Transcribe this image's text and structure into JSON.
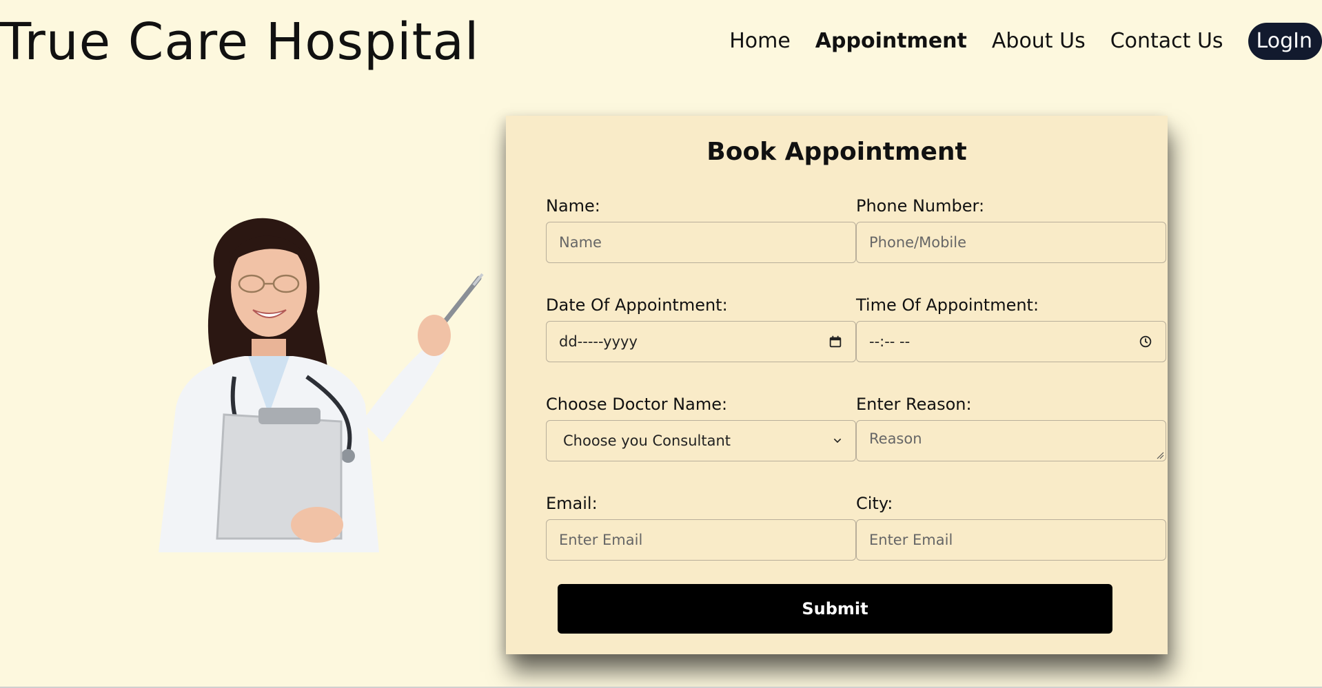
{
  "header": {
    "brand": "True Care Hospital",
    "nav": [
      {
        "label": "Home",
        "active": false
      },
      {
        "label": "Appointment",
        "active": true
      },
      {
        "label": "About Us",
        "active": false
      },
      {
        "label": "Contact Us",
        "active": false
      }
    ],
    "login_label": "LogIn"
  },
  "form": {
    "title": "Book Appointment",
    "fields": {
      "name": {
        "label": "Name:",
        "placeholder": "Name"
      },
      "phone": {
        "label": "Phone Number:",
        "placeholder": "Phone/Mobile"
      },
      "date": {
        "label": "Date Of Appointment:",
        "value": "dd-----yyyy",
        "icon": "calendar-icon"
      },
      "time": {
        "label": "Time Of Appointment:",
        "value": "--:-- --",
        "icon": "clock-icon"
      },
      "doctor": {
        "label": "Choose Doctor Name:",
        "selected": "Choose you Consultant",
        "icon": "chevron-down-icon"
      },
      "reason": {
        "label": "Enter Reason:",
        "placeholder": "Reason"
      },
      "email": {
        "label": "Email:",
        "placeholder": "Enter Email"
      },
      "city": {
        "label": "City:",
        "placeholder": "Enter Email"
      }
    },
    "submit_label": "Submit"
  },
  "colors": {
    "page_bg": "#fdf8de",
    "card_bg": "#f9ebc8",
    "login_bg": "#121a2e",
    "submit_bg": "#000000"
  }
}
